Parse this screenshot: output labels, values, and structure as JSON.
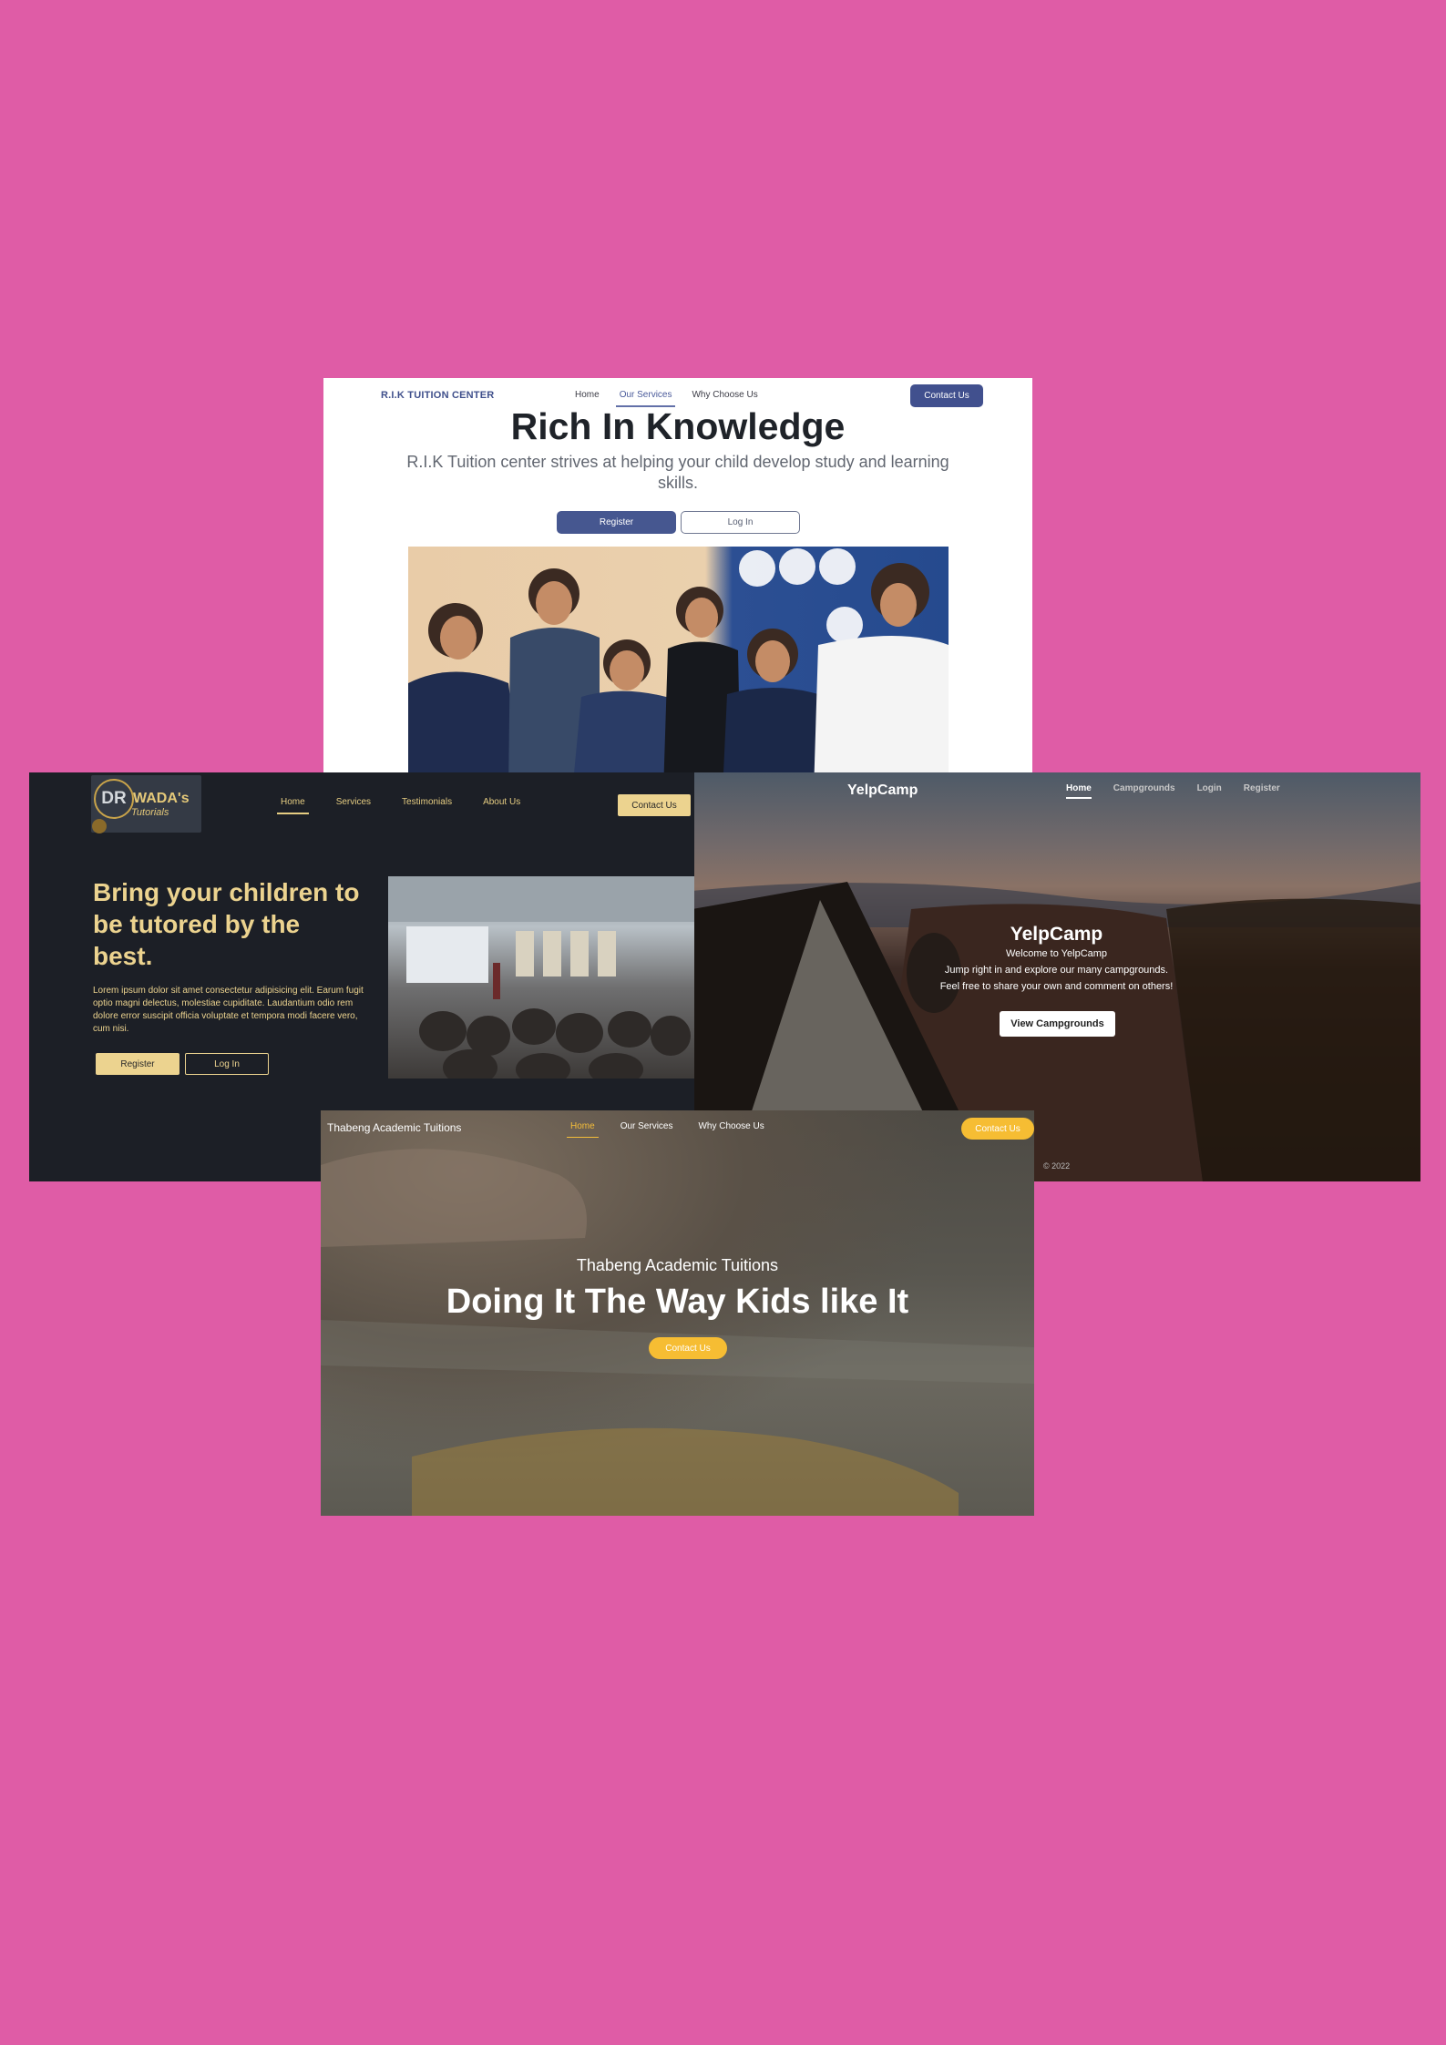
{
  "rik": {
    "brand": "R.I.K TUITION CENTER",
    "nav": [
      "Home",
      "Our Services",
      "Why Choose Us"
    ],
    "contact": "Contact Us",
    "title": "Rich In Knowledge",
    "subtitle": "R.I.K Tuition center strives at helping your child develop study and learning skills.",
    "register": "Register",
    "login": "Log In",
    "colors": {
      "accent": "#41508e"
    }
  },
  "wada": {
    "logo_text": "DR",
    "logo_name": "WADA's",
    "logo_script": "Tutorials",
    "nav": [
      "Home",
      "Services",
      "Testimonials",
      "About Us"
    ],
    "contact": "Contact Us",
    "heading": "Bring your children to be tutored by the best.",
    "paragraph": "Lorem ipsum dolor sit amet consectetur adipisicing elit. Earum fugit optio magni delectus, molestiae cupiditate. Laudantium odio rem dolore error suscipit officia voluptate et tempora modi facere vero, cum nisi.",
    "register": "Register",
    "login": "Log In",
    "colors": {
      "accent": "#ecd38f",
      "background": "#1c1f26"
    }
  },
  "yelp": {
    "brand": "YelpCamp",
    "nav": [
      "Home",
      "Campgrounds",
      "Login",
      "Register"
    ],
    "title": "YelpCamp",
    "lines": [
      "Welcome to YelpCamp",
      "Jump right in and explore our many campgrounds.",
      "Feel free to share your own and comment on others!"
    ],
    "button": "View Campgrounds",
    "footer": "© 2022"
  },
  "thabeng": {
    "brand": "Thabeng Academic Tuitions",
    "nav": [
      "Home",
      "Our Services",
      "Why Choose Us"
    ],
    "contact": "Contact Us",
    "subtitle": "Thabeng Academic Tuitions",
    "title": "Doing It The Way Kids like It",
    "button": "Contact Us",
    "colors": {
      "accent": "#f6bd33"
    }
  }
}
